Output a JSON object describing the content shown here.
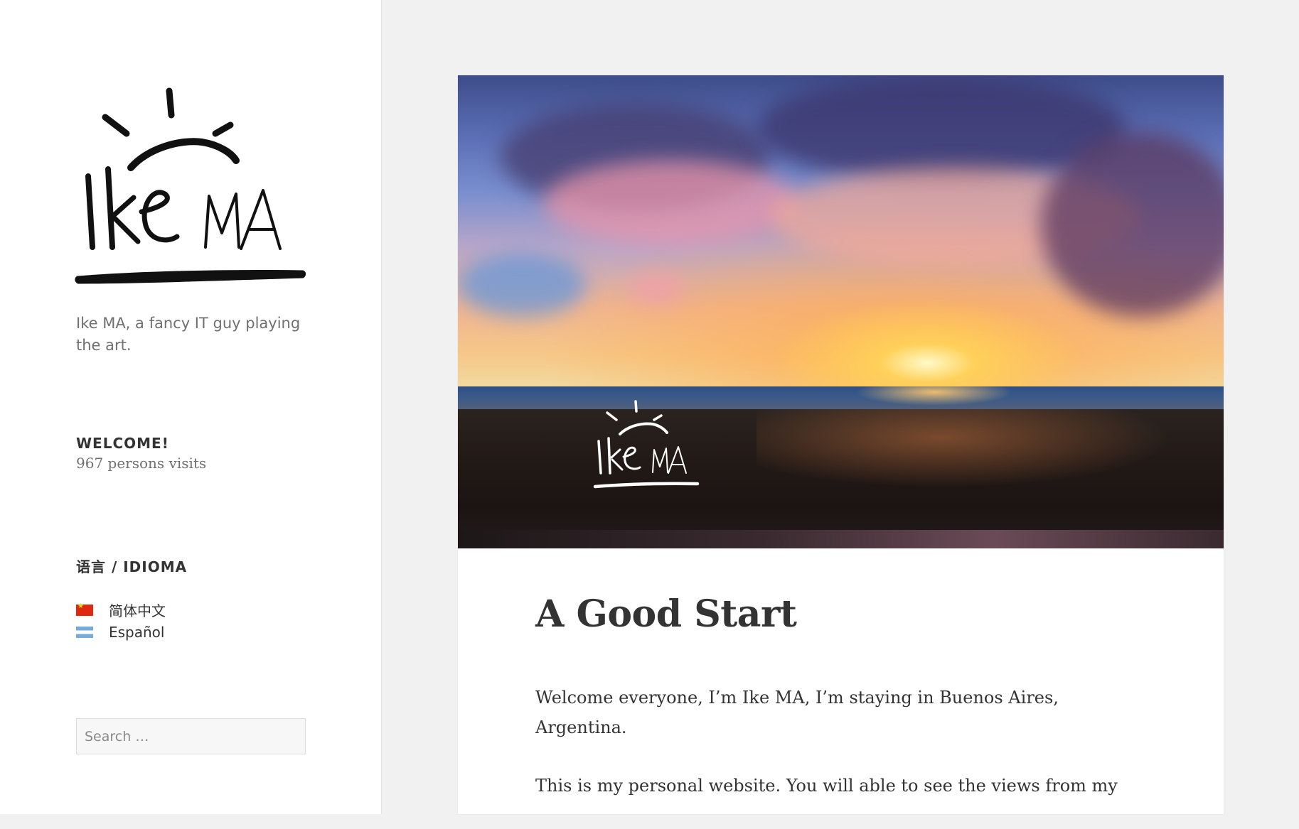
{
  "site": {
    "logo_alt": "Ike MA",
    "tagline": "Ike MA, a fancy IT guy playing the art."
  },
  "widgets": {
    "welcome": {
      "title": "WELCOME!",
      "visits": "967 persons visits"
    },
    "language": {
      "title": "语言 / IDIOMA",
      "items": [
        {
          "label": "简体中文",
          "flag": "cn-flag-icon"
        },
        {
          "label": "Español",
          "flag": "ar-flag-icon"
        }
      ]
    },
    "search": {
      "placeholder": "Search …"
    }
  },
  "post": {
    "title": "A Good Start",
    "paragraphs": [
      "Welcome everyone, I’m Ike MA, I’m staying in Buenos Aires, Argentina.",
      "This is my personal website. You will able to see the views from my"
    ]
  },
  "colors": {
    "page_bg": "#f1f1f1",
    "sidebar_bg": "#ffffff",
    "text": "#333333",
    "muted_text": "#707070"
  }
}
